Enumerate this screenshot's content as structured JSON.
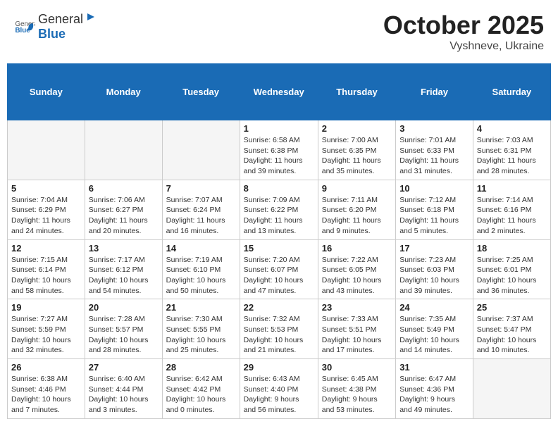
{
  "header": {
    "logo_general": "General",
    "logo_blue": "Blue",
    "title": "October 2025",
    "location": "Vyshneve, Ukraine"
  },
  "days_of_week": [
    "Sunday",
    "Monday",
    "Tuesday",
    "Wednesday",
    "Thursday",
    "Friday",
    "Saturday"
  ],
  "weeks": [
    [
      {
        "day": "",
        "info": ""
      },
      {
        "day": "",
        "info": ""
      },
      {
        "day": "",
        "info": ""
      },
      {
        "day": "1",
        "info": "Sunrise: 6:58 AM\nSunset: 6:38 PM\nDaylight: 11 hours\nand 39 minutes."
      },
      {
        "day": "2",
        "info": "Sunrise: 7:00 AM\nSunset: 6:35 PM\nDaylight: 11 hours\nand 35 minutes."
      },
      {
        "day": "3",
        "info": "Sunrise: 7:01 AM\nSunset: 6:33 PM\nDaylight: 11 hours\nand 31 minutes."
      },
      {
        "day": "4",
        "info": "Sunrise: 7:03 AM\nSunset: 6:31 PM\nDaylight: 11 hours\nand 28 minutes."
      }
    ],
    [
      {
        "day": "5",
        "info": "Sunrise: 7:04 AM\nSunset: 6:29 PM\nDaylight: 11 hours\nand 24 minutes."
      },
      {
        "day": "6",
        "info": "Sunrise: 7:06 AM\nSunset: 6:27 PM\nDaylight: 11 hours\nand 20 minutes."
      },
      {
        "day": "7",
        "info": "Sunrise: 7:07 AM\nSunset: 6:24 PM\nDaylight: 11 hours\nand 16 minutes."
      },
      {
        "day": "8",
        "info": "Sunrise: 7:09 AM\nSunset: 6:22 PM\nDaylight: 11 hours\nand 13 minutes."
      },
      {
        "day": "9",
        "info": "Sunrise: 7:11 AM\nSunset: 6:20 PM\nDaylight: 11 hours\nand 9 minutes."
      },
      {
        "day": "10",
        "info": "Sunrise: 7:12 AM\nSunset: 6:18 PM\nDaylight: 11 hours\nand 5 minutes."
      },
      {
        "day": "11",
        "info": "Sunrise: 7:14 AM\nSunset: 6:16 PM\nDaylight: 11 hours\nand 2 minutes."
      }
    ],
    [
      {
        "day": "12",
        "info": "Sunrise: 7:15 AM\nSunset: 6:14 PM\nDaylight: 10 hours\nand 58 minutes."
      },
      {
        "day": "13",
        "info": "Sunrise: 7:17 AM\nSunset: 6:12 PM\nDaylight: 10 hours\nand 54 minutes."
      },
      {
        "day": "14",
        "info": "Sunrise: 7:19 AM\nSunset: 6:10 PM\nDaylight: 10 hours\nand 50 minutes."
      },
      {
        "day": "15",
        "info": "Sunrise: 7:20 AM\nSunset: 6:07 PM\nDaylight: 10 hours\nand 47 minutes."
      },
      {
        "day": "16",
        "info": "Sunrise: 7:22 AM\nSunset: 6:05 PM\nDaylight: 10 hours\nand 43 minutes."
      },
      {
        "day": "17",
        "info": "Sunrise: 7:23 AM\nSunset: 6:03 PM\nDaylight: 10 hours\nand 39 minutes."
      },
      {
        "day": "18",
        "info": "Sunrise: 7:25 AM\nSunset: 6:01 PM\nDaylight: 10 hours\nand 36 minutes."
      }
    ],
    [
      {
        "day": "19",
        "info": "Sunrise: 7:27 AM\nSunset: 5:59 PM\nDaylight: 10 hours\nand 32 minutes."
      },
      {
        "day": "20",
        "info": "Sunrise: 7:28 AM\nSunset: 5:57 PM\nDaylight: 10 hours\nand 28 minutes."
      },
      {
        "day": "21",
        "info": "Sunrise: 7:30 AM\nSunset: 5:55 PM\nDaylight: 10 hours\nand 25 minutes."
      },
      {
        "day": "22",
        "info": "Sunrise: 7:32 AM\nSunset: 5:53 PM\nDaylight: 10 hours\nand 21 minutes."
      },
      {
        "day": "23",
        "info": "Sunrise: 7:33 AM\nSunset: 5:51 PM\nDaylight: 10 hours\nand 17 minutes."
      },
      {
        "day": "24",
        "info": "Sunrise: 7:35 AM\nSunset: 5:49 PM\nDaylight: 10 hours\nand 14 minutes."
      },
      {
        "day": "25",
        "info": "Sunrise: 7:37 AM\nSunset: 5:47 PM\nDaylight: 10 hours\nand 10 minutes."
      }
    ],
    [
      {
        "day": "26",
        "info": "Sunrise: 6:38 AM\nSunset: 4:46 PM\nDaylight: 10 hours\nand 7 minutes."
      },
      {
        "day": "27",
        "info": "Sunrise: 6:40 AM\nSunset: 4:44 PM\nDaylight: 10 hours\nand 3 minutes."
      },
      {
        "day": "28",
        "info": "Sunrise: 6:42 AM\nSunset: 4:42 PM\nDaylight: 10 hours\nand 0 minutes."
      },
      {
        "day": "29",
        "info": "Sunrise: 6:43 AM\nSunset: 4:40 PM\nDaylight: 9 hours\nand 56 minutes."
      },
      {
        "day": "30",
        "info": "Sunrise: 6:45 AM\nSunset: 4:38 PM\nDaylight: 9 hours\nand 53 minutes."
      },
      {
        "day": "31",
        "info": "Sunrise: 6:47 AM\nSunset: 4:36 PM\nDaylight: 9 hours\nand 49 minutes."
      },
      {
        "day": "",
        "info": ""
      }
    ]
  ]
}
